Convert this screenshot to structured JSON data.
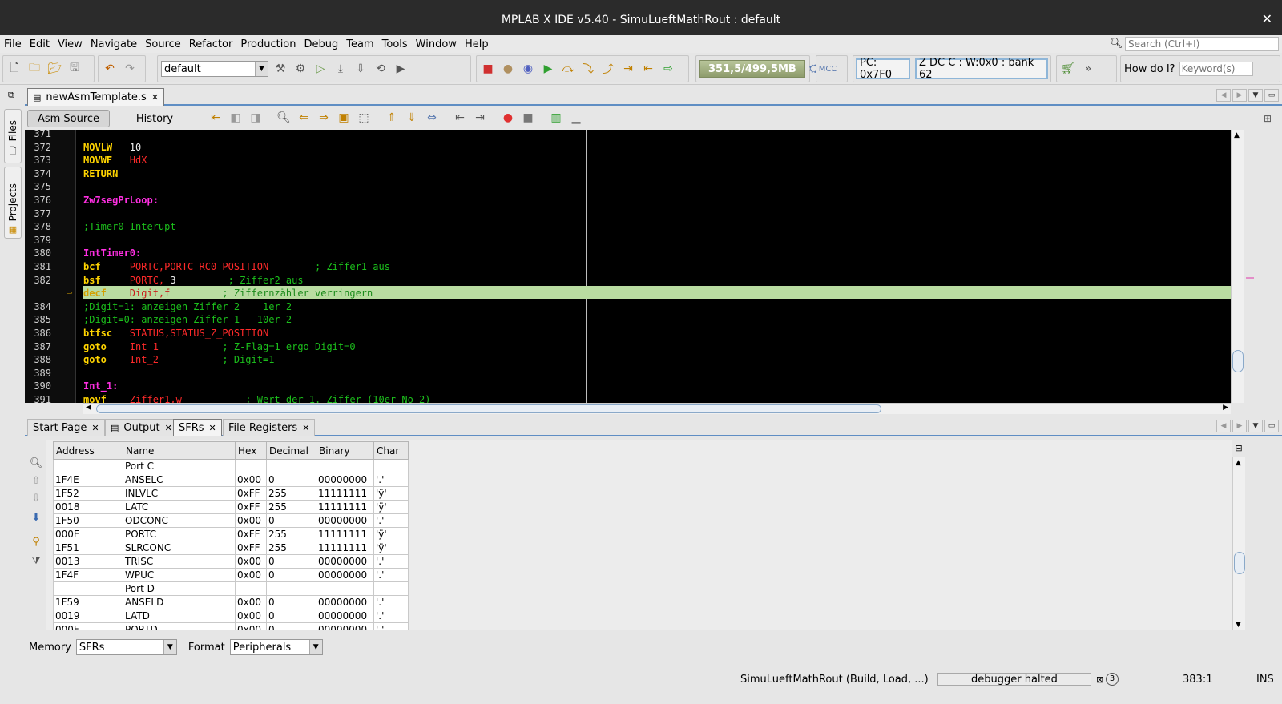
{
  "window": {
    "title": "MPLAB X IDE v5.40 - SimuLueftMathRout : default",
    "close": "✕"
  },
  "menubar": {
    "items": [
      "File",
      "Edit",
      "View",
      "Navigate",
      "Source",
      "Refactor",
      "Production",
      "Debug",
      "Team",
      "Tools",
      "Window",
      "Help"
    ],
    "search_placeholder": "Search (Ctrl+I)"
  },
  "toolbar": {
    "configuration": "default",
    "memory_meter": "351,5/499,5MB",
    "pc_label": "PC: 0x7F0",
    "status_reg": "Z DC C  : W:0x0 : bank 62",
    "howdoi_label": "How do I?",
    "howdoi_placeholder": "Keyword(s)"
  },
  "side_tabs": {
    "files": "Files",
    "projects": "Projects"
  },
  "editor": {
    "file_tab": "newAsmTemplate.s",
    "views": {
      "source": "Asm Source",
      "history": "History"
    },
    "lines": [
      {
        "num": "371",
        "tokens": []
      },
      {
        "num": "372",
        "tokens": [
          {
            "t": "MOVLW",
            "c": "instr"
          },
          {
            "t": "   10",
            "c": "num"
          }
        ]
      },
      {
        "num": "373",
        "tokens": [
          {
            "t": "MOVWF",
            "c": "instr"
          },
          {
            "t": "   HdX",
            "c": "red"
          }
        ]
      },
      {
        "num": "374",
        "tokens": [
          {
            "t": "RETURN",
            "c": "instr"
          }
        ]
      },
      {
        "num": "375",
        "tokens": []
      },
      {
        "num": "376",
        "tokens": [
          {
            "t": "Zw7segPrLoop:",
            "c": "label"
          }
        ]
      },
      {
        "num": "377",
        "tokens": []
      },
      {
        "num": "378",
        "tokens": [
          {
            "t": ";Timer0-Interupt",
            "c": "comment"
          }
        ]
      },
      {
        "num": "379",
        "tokens": []
      },
      {
        "num": "380",
        "tokens": [
          {
            "t": "IntTimer0:",
            "c": "label"
          }
        ]
      },
      {
        "num": "381",
        "tokens": [
          {
            "t": "bcf",
            "c": "instr"
          },
          {
            "t": "     PORTC,PORTC_RC0_POSITION",
            "c": "red"
          },
          {
            "t": "        ; Ziffer1 aus",
            "c": "comment"
          }
        ]
      },
      {
        "num": "382",
        "tokens": [
          {
            "t": "bsf",
            "c": "instr"
          },
          {
            "t": "     PORTC,",
            "c": "red"
          },
          {
            "t": " 3",
            "c": "num"
          },
          {
            "t": "         ; Ziffer2 aus",
            "c": "comment"
          }
        ]
      },
      {
        "num": "383",
        "current": true,
        "tokens": [
          {
            "t": "decf",
            "c": "instr"
          },
          {
            "t": "    Digit,f",
            "c": "red"
          },
          {
            "t": "         ; Ziffernzähler verringern",
            "c": "comment"
          }
        ]
      },
      {
        "num": "384",
        "tokens": [
          {
            "t": ";Digit=1: anzeigen Ziffer 2    1er 2",
            "c": "comment"
          }
        ]
      },
      {
        "num": "385",
        "tokens": [
          {
            "t": ";Digit=0: anzeigen Ziffer 1   10er 2",
            "c": "comment"
          }
        ]
      },
      {
        "num": "386",
        "tokens": [
          {
            "t": "btfsc",
            "c": "instr"
          },
          {
            "t": "   STATUS,STATUS_Z_POSITION",
            "c": "red"
          }
        ]
      },
      {
        "num": "387",
        "tokens": [
          {
            "t": "goto",
            "c": "instr"
          },
          {
            "t": "    Int_1",
            "c": "red"
          },
          {
            "t": "           ; Z-Flag=1 ergo Digit=0",
            "c": "comment"
          }
        ]
      },
      {
        "num": "388",
        "tokens": [
          {
            "t": "goto",
            "c": "instr"
          },
          {
            "t": "    Int_2",
            "c": "red"
          },
          {
            "t": "           ; Digit=1",
            "c": "comment"
          }
        ]
      },
      {
        "num": "389",
        "tokens": []
      },
      {
        "num": "390",
        "tokens": [
          {
            "t": "Int_1:",
            "c": "label"
          }
        ]
      },
      {
        "num": "391",
        "tokens": [
          {
            "t": "movf",
            "c": "instr"
          },
          {
            "t": "    Ziffer1,w",
            "c": "red"
          },
          {
            "t": "           ; Wert der 1. Ziffer (10er No 2)",
            "c": "comment"
          }
        ]
      }
    ],
    "current_marker": "⇨"
  },
  "bottom_tabs": [
    "Start Page",
    "Output",
    "SFRs",
    "File Registers"
  ],
  "sfr_table": {
    "columns": [
      "Address",
      "Name",
      "Hex",
      "Decimal",
      "Binary",
      "Char"
    ],
    "rows": [
      {
        "group": "Port C"
      },
      {
        "cells": [
          "1F4E",
          "ANSELC",
          "0x00",
          "0",
          "00000000",
          "'.'"
        ]
      },
      {
        "cells": [
          "1F52",
          "INLVLC",
          "0xFF",
          "255",
          "11111111",
          "'ÿ'"
        ]
      },
      {
        "cells": [
          "0018",
          "LATC",
          "0xFF",
          "255",
          "11111111",
          "'ÿ'"
        ]
      },
      {
        "cells": [
          "1F50",
          "ODCONC",
          "0x00",
          "0",
          "00000000",
          "'.'"
        ]
      },
      {
        "cells": [
          "000E",
          "PORTC",
          "0xFF",
          "255",
          "11111111",
          "'ÿ'"
        ]
      },
      {
        "cells": [
          "1F51",
          "SLRCONC",
          "0xFF",
          "255",
          "11111111",
          "'ÿ'"
        ]
      },
      {
        "cells": [
          "0013",
          "TRISC",
          "0x00",
          "0",
          "00000000",
          "'.'"
        ]
      },
      {
        "cells": [
          "1F4F",
          "WPUC",
          "0x00",
          "0",
          "00000000",
          "'.'"
        ]
      },
      {
        "group": "Port D"
      },
      {
        "cells": [
          "1F59",
          "ANSELD",
          "0x00",
          "0",
          "00000000",
          "'.'"
        ]
      },
      {
        "cells": [
          "0019",
          "LATD",
          "0x00",
          "0",
          "00000000",
          "'.'"
        ]
      },
      {
        "cells": [
          "000F",
          "PORTD",
          "0x00",
          "0",
          "00000000",
          "'.'"
        ]
      }
    ]
  },
  "memory": {
    "label": "Memory",
    "value": "SFRs",
    "format_label": "Format",
    "format_value": "Peripherals"
  },
  "statusbar": {
    "project": "SimuLueftMathRout (Build, Load, ...)",
    "state": "debugger halted",
    "badge": "3",
    "position": "383:1",
    "mode": "INS"
  },
  "colors": {
    "accent": "#5f8ec4",
    "current_line": "#b9dca1",
    "editor_bg": "#000000"
  }
}
